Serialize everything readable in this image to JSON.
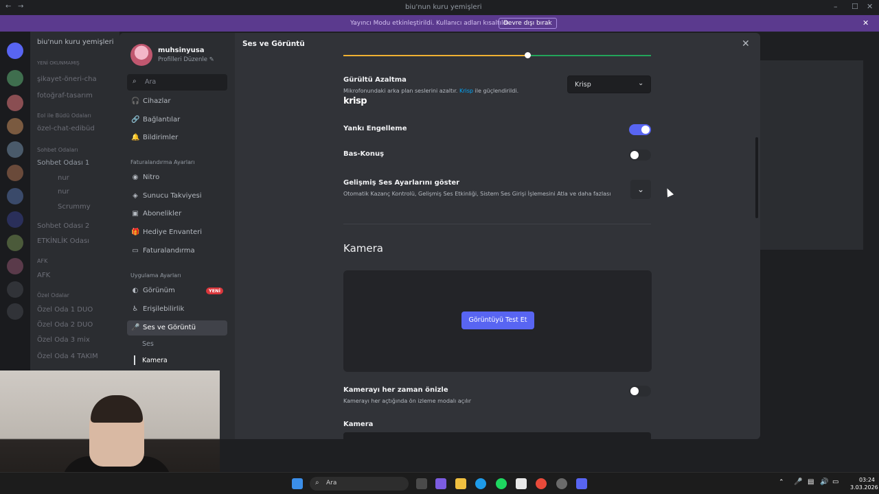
{
  "window": {
    "title": "biu'nun kuru yemişleri"
  },
  "streamer_mode": {
    "message": "Yayıncı Modu etkinleştirildi. Kullanıcı adları kısaltıldı.",
    "disable_label": "Devre dışı bırak"
  },
  "background_channels": {
    "server_name": "biu'nun kuru yemişleri",
    "items": [
      "YENİ OKUNMAMIŞ",
      "şikayet-öneri-cha",
      "fotoğraf-tasarım",
      "Eol ile Büdü Odaları",
      "özel-chat-edibüd",
      "Sohbet Odaları",
      "Sohbet Odası 1",
      "nur",
      "Scrummy",
      "Sohbet Odası 2",
      "ETKİNLİK Odası",
      "AFK",
      "AFK",
      "Özel Odalar",
      "Özel Oda 1 DUO",
      "Özel Oda 2 DUO",
      "Özel Oda 3 mix",
      "Özel Oda 4 TAKIM"
    ]
  },
  "sidebar": {
    "username": "muhsinyusa",
    "edit_profile": "Profilleri Düzenle ✎",
    "search_placeholder": "Ara",
    "items_top": [
      {
        "label": "Cihazlar",
        "icon": "🎧"
      },
      {
        "label": "Bağlantılar",
        "icon": "🔗"
      },
      {
        "label": "Bildirimler",
        "icon": "🔔"
      }
    ],
    "billing_header": "Faturalandırma Ayarları",
    "billing_items": [
      {
        "label": "Nitro",
        "icon": "◉"
      },
      {
        "label": "Sunucu Takviyesi",
        "icon": "◈"
      },
      {
        "label": "Abonelikler",
        "icon": "▣"
      },
      {
        "label": "Hediye Envanteri",
        "icon": "🎁"
      },
      {
        "label": "Faturalandırma",
        "icon": "▭"
      }
    ],
    "app_header": "Uygulama Ayarları",
    "app_items": [
      {
        "label": "Görünüm",
        "icon": "◐",
        "badge": "YENİ"
      },
      {
        "label": "Erişilebilirlik",
        "icon": "♿"
      },
      {
        "label": "Ses ve Görüntü",
        "icon": "🎤"
      }
    ],
    "sub_items": [
      "Ses",
      "Kamera"
    ]
  },
  "content": {
    "title": "Ses ve Görüntü",
    "noise": {
      "title": "Gürültü Azaltma",
      "desc_before": "Mikrofonundaki arka plan seslerini azaltır. ",
      "desc_link": "Krisp",
      "desc_after": " ile güçlendirildi.",
      "logo": "krisp",
      "selected": "Krisp"
    },
    "echo": {
      "title": "Yankı Engelleme",
      "enabled": true
    },
    "ptt": {
      "title": "Bas-Konuş",
      "enabled": false
    },
    "advanced": {
      "title": "Gelişmiş Ses Ayarlarını göster",
      "desc": "Otomatik Kazanç Kontrolü, Gelişmiş Ses Etkinliği, Sistem Ses Girişi İşlemesini Atla ve daha fazlası"
    },
    "camera_section": "Kamera",
    "test_button": "Görüntüyü Test Et",
    "preview_always": {
      "title": "Kamerayı her zaman önizle",
      "desc": "Kamerayı her açtığında ön izleme modalı açılır",
      "enabled": false
    },
    "camera_label": "Kamera"
  },
  "taskbar": {
    "search": "Ara",
    "time": "03:24",
    "date": "3.03.2026"
  }
}
